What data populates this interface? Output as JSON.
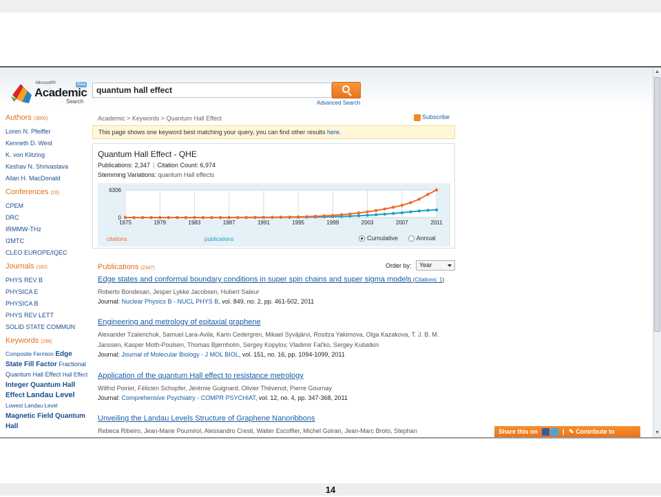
{
  "header": {
    "logo_ms": "Microsoft®",
    "logo_academic": "Academic",
    "logo_search": "Search",
    "logo_beta": "Beta",
    "search_value": "quantum hall effect",
    "advanced_search": "Advanced Search"
  },
  "sidebar": {
    "authors": {
      "label": "Authors",
      "count": "(3800)",
      "items": [
        "Loren N. Pfeiffer",
        "Kenneth D. West",
        "K. von Klitzing",
        "Keshav N. Shrivastava",
        "Allan H. MacDonald"
      ]
    },
    "conferences": {
      "label": "Conferences",
      "count": "(10)",
      "items": [
        "CPEM",
        "DRC",
        "IRMMW-THz",
        "I2MTC",
        "CLEO EUROPE/IQEC"
      ]
    },
    "journals": {
      "label": "Journals",
      "count": "(182)",
      "items": [
        "PHYS REV B",
        "PHYSICA E",
        "PHYSICA B",
        "PHYS REV LETT",
        "SOLID STATE COMMUN"
      ]
    },
    "keywords": {
      "label": "Keywords",
      "count": "(296)",
      "items": [
        "Composite Fermion",
        "Edge State",
        "Fill Factor",
        "Fractional Quantum Hall Effect",
        "Hall Effect",
        "Integer Quantum Hall Effect",
        "Landau Level",
        "Lowest Landau Level",
        "Magnetic Field",
        "Quantum Hall"
      ]
    }
  },
  "breadcrumb": {
    "academic": "Academic",
    "keywords": "Keywords",
    "current": "Quantum Hall Effect",
    "sep": ">"
  },
  "subscribe": "Subscribe",
  "notice": {
    "text": "This page shows one keyword best matching your query, you can find other results ",
    "link": "here",
    "end": "."
  },
  "keyword_box": {
    "title": "Quantum Hall Effect - QHE",
    "publications_label": "Publications: 2,347",
    "citations_label": "Citation Count: 6,974",
    "stemming_label": "Stemming Variations:",
    "stemming_value": "quantum Hall effects",
    "legend_publications": "publications",
    "legend_citations": "citations",
    "radio_cumulative": "Cumulative",
    "radio_annual": "Annual"
  },
  "chart_data": {
    "type": "line",
    "x": [
      1975,
      1976,
      1977,
      1978,
      1979,
      1980,
      1981,
      1982,
      1983,
      1984,
      1985,
      1986,
      1987,
      1988,
      1989,
      1990,
      1991,
      1992,
      1993,
      1994,
      1995,
      1996,
      1997,
      1998,
      1999,
      2000,
      2001,
      2002,
      2003,
      2004,
      2005,
      2006,
      2007,
      2008,
      2009,
      2010,
      2011
    ],
    "x_tick_labels": [
      "1975",
      "1979",
      "1983",
      "1987",
      "1991",
      "1995",
      "1999",
      "2003",
      "2007",
      "2011"
    ],
    "y_tick_labels": [
      "6306",
      "0"
    ],
    "ylim": [
      0,
      6306
    ],
    "series": [
      {
        "name": "publications",
        "color": "#1aa0c8",
        "values": [
          0,
          0,
          0,
          0,
          0,
          0,
          0,
          0,
          0,
          0,
          0,
          0,
          0,
          5,
          10,
          15,
          20,
          30,
          40,
          55,
          70,
          90,
          120,
          160,
          200,
          260,
          330,
          420,
          520,
          640,
          780,
          930,
          1100,
          1300,
          1500,
          1650,
          1750
        ]
      },
      {
        "name": "citations",
        "color": "#ef6a26",
        "values": [
          0,
          0,
          0,
          0,
          0,
          0,
          0,
          0,
          0,
          0,
          0,
          0,
          0,
          10,
          20,
          30,
          45,
          60,
          80,
          110,
          150,
          200,
          280,
          380,
          500,
          650,
          820,
          1050,
          1300,
          1600,
          1950,
          2350,
          2800,
          3400,
          4200,
          5300,
          6306
        ]
      }
    ],
    "grid": true
  },
  "publications": {
    "label": "Publications",
    "count": "(2347)",
    "order_by_label": "Order by:",
    "order_by_value": "Year",
    "items": [
      {
        "title": "Edge states and conformal boundary conditions in super spin chains and super sigma models",
        "citations_prefix": " (",
        "citations_link": "Citations: 1",
        "citations_suffix": ")",
        "authors": "Roberto Bondesan,  Jesper Lykke Jacobsen,  Hubert Saleur",
        "journal_prefix": "Journal: ",
        "journal": "Nuclear Physics B - NUCL PHYS B",
        "journal_suffix": ", vol. 849, no. 2, pp. 461-502, 2011"
      },
      {
        "title": "Engineering and metrology of epitaxial graphene",
        "authors": "Alexander Tzalenchuk,  Samuel Lara-Avila,  Karin Cedergren,  Mikael Syväjärvi,  Rositza Yakimova,  Olga Kazakova,  T. J. B. M. Janssen,  Kasper Moth-Poulsen,  Thomas Bjørnholm,  Sergey Kopylov,  Vladimir Fal'ko,  Sergey Kubatkin",
        "journal_prefix": "Journal: ",
        "journal": "Journal of Molecular Biology - J MOL BIOL",
        "journal_suffix": ", vol. 151, no. 16, pp. 1094-1099, 2011"
      },
      {
        "title": "Application of the quantum Hall effect to resistance metrology",
        "authors": "Wilfrid Poirier,  Félicien Schopfer,  Jérémie Guignard,  Olivier Thévenot,  Pierre Gournay",
        "journal_prefix": "Journal: ",
        "journal": "Comprehensive Psychiatry - COMPR PSYCHIAT",
        "journal_suffix": ", vol. 12, no. 4, pp. 347-368, 2011"
      },
      {
        "title": "Unveiling the Landau Levels Structure of Graphene Nanoribbons",
        "authors": "Rebeca Ribeiro,  Jean-Marie Poumirol,  Alessandro Cresti,  Walter Escoffier,  Michel Goiran,  Jean-Marc Broto,  Stephan"
      }
    ]
  },
  "share": {
    "label": "Share this on",
    "contribute": "Contribute to Academic",
    "sep": "|"
  },
  "page_number": "14",
  "colors": {
    "accent": "#e36d1b",
    "link": "#1a5aa6",
    "publications": "#1aa0c8",
    "citations": "#ef6a26"
  }
}
